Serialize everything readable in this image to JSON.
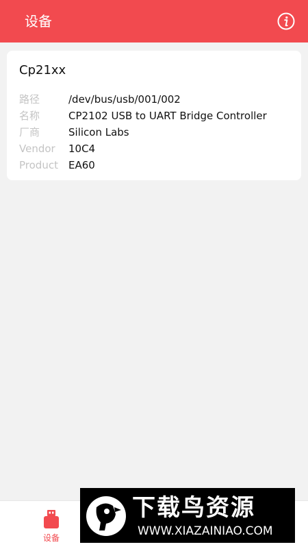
{
  "header": {
    "title": "设备",
    "info_icon": "info-circle-icon",
    "background": "#f24a4f"
  },
  "device": {
    "name": "Cp21xx",
    "rows": [
      {
        "label": "路径",
        "value": "/dev/bus/usb/001/002"
      },
      {
        "label": "名称",
        "value": "CP2102 USB to UART Bridge Controller"
      },
      {
        "label": "厂商",
        "value": "Silicon Labs"
      },
      {
        "label": "Vendor",
        "value": "10C4"
      },
      {
        "label": "Product",
        "value": "EA60"
      }
    ]
  },
  "bottom_nav": {
    "items": [
      {
        "label": "设备",
        "icon": "usb-drive-icon",
        "active": true
      }
    ]
  },
  "watermark": {
    "title": "下载鸟资源",
    "url": "WWW.XIAZAINIAO.COM",
    "logo_icon": "bird-logo-icon"
  }
}
